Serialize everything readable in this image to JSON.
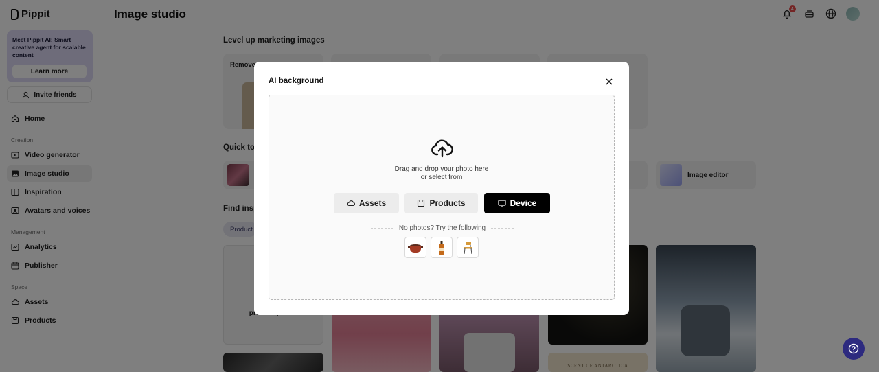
{
  "app": {
    "brand": "Pippit",
    "page_title": "Image studio",
    "notification_count": "4"
  },
  "sidebar": {
    "promo_text": "Meet Pippit AI: Smart creative agent for scalable content",
    "promo_button": "Learn more",
    "invite_label": "Invite friends",
    "home": "Home",
    "sections": {
      "creation": "Creation",
      "management": "Management",
      "space": "Space"
    },
    "creation_items": [
      "Video generator",
      "Image studio",
      "Inspiration",
      "Avatars and voices"
    ],
    "management_items": [
      "Analytics",
      "Publisher"
    ],
    "space_items": [
      "Assets",
      "Products"
    ]
  },
  "main": {
    "section_marketing": "Level up marketing images",
    "feature_first_label": "Remove",
    "section_quick": "Quick to",
    "quick_tool_partial": "I",
    "quick_tool_editor": "Image editor",
    "section_inspiration": "Find insp",
    "filter_chip": "Product",
    "tile_caption_1": "C",
    "tile_caption_2": "product poster",
    "tile_caption_3": "SCENT OF ANTARCTICA"
  },
  "modal": {
    "title": "AI background",
    "drop_line_1": "Drag and drop your photo here",
    "drop_line_2": "or select from",
    "buttons": {
      "assets": "Assets",
      "products": "Products",
      "device": "Device"
    },
    "try_text": "No photos? Try the following",
    "samples": [
      "pot-sample",
      "bottle-sample",
      "chair-sample"
    ]
  },
  "colors": {
    "overlay": "rgba(0,0,0,0.5)",
    "promo_bg": "#dcd9f4",
    "help_button": "#2d2a7f",
    "device_button": "#000000",
    "badge": "#e84a4a"
  }
}
